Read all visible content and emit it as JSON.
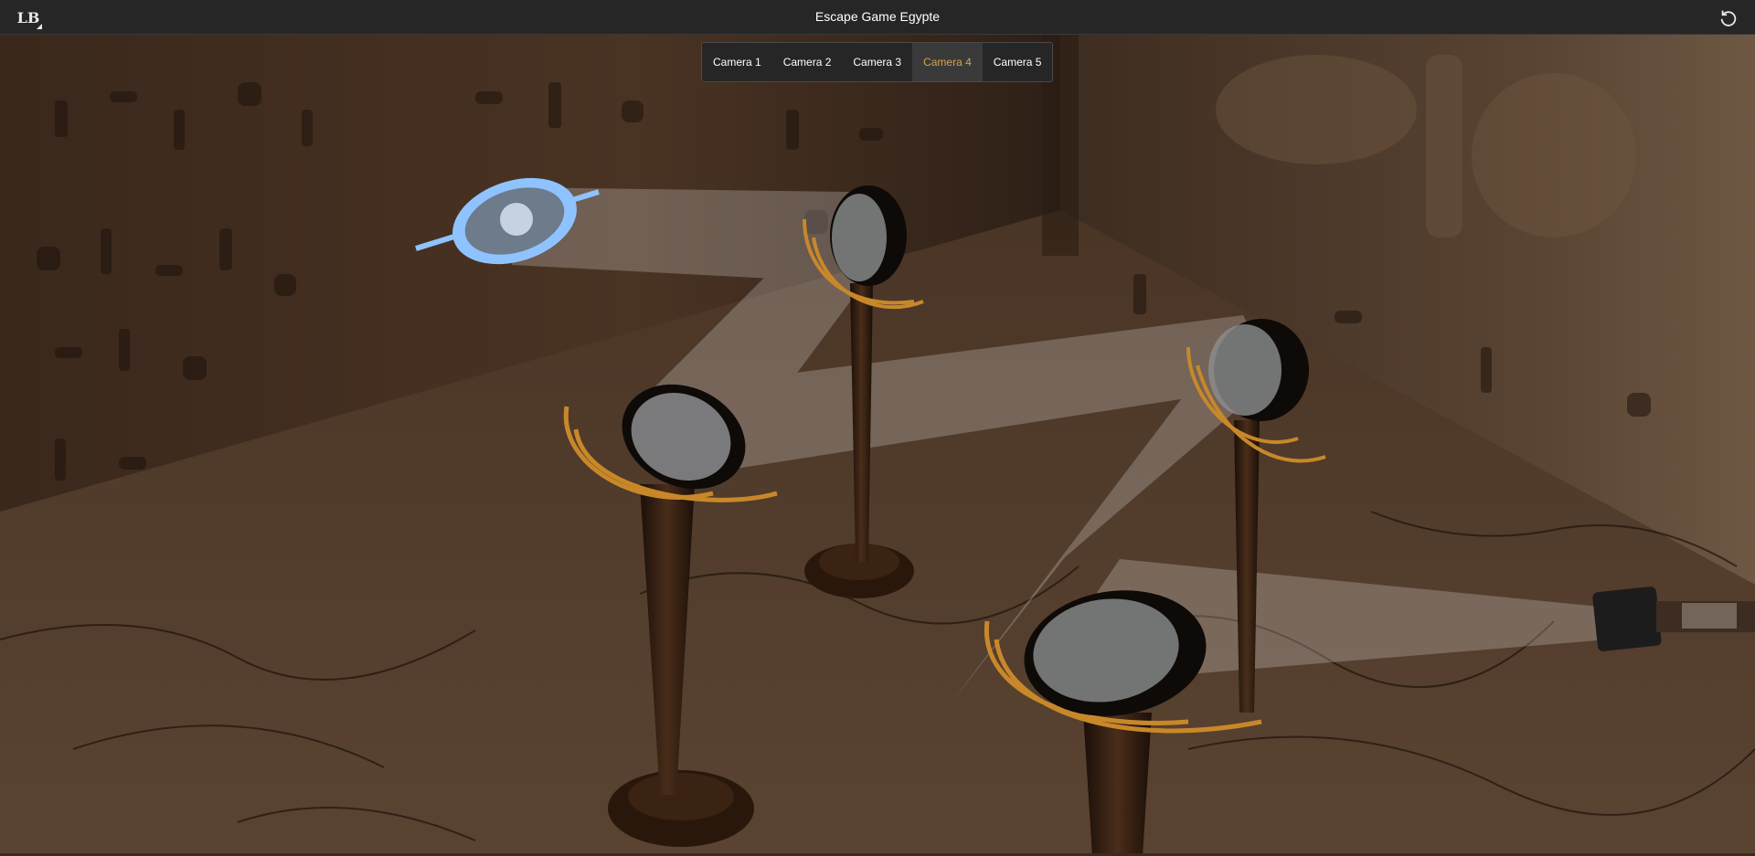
{
  "app": {
    "title": "Escape Game Egypte",
    "logo_glyph": "LB",
    "logo_icon": "app-logo-icon",
    "reset_icon": "reset-rotate-icon"
  },
  "cameras": [
    {
      "label": "Camera 1",
      "active": false
    },
    {
      "label": "Camera 2",
      "active": false
    },
    {
      "label": "Camera 3",
      "active": false
    },
    {
      "label": "Camera 4",
      "active": true
    },
    {
      "label": "Camera 5",
      "active": false
    }
  ],
  "colors": {
    "topbar_bg": "#262626",
    "active_camera_text": "#d8a24a",
    "selected_mirror": "#8fc3ff",
    "mirror_gold": "#c8882a",
    "light_beam": "#ffffff"
  }
}
